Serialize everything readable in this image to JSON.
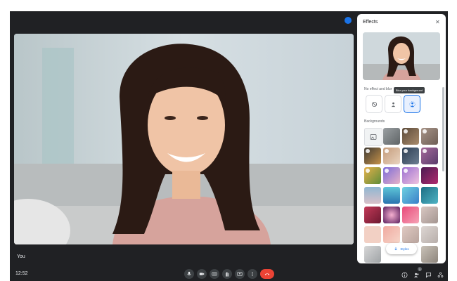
{
  "meeting": {
    "self_label": "You",
    "time": "12:52"
  },
  "effects_panel": {
    "title": "Effects",
    "close_glyph": "✕",
    "no_effect_section": "No effect and blur",
    "tooltip": "Blur your background",
    "backgrounds_section": "Backgrounds",
    "styles_label": "Styles"
  },
  "colors": {
    "accent": "#1a73e8",
    "end_call": "#ea4335",
    "toolbar": "#202124"
  },
  "controls": {
    "bottom_center": [
      "mic-icon",
      "camera-icon",
      "captions-icon",
      "raise-hand-icon",
      "present-icon",
      "more-options-icon",
      "end-call-icon"
    ],
    "bottom_right": [
      "info-icon",
      "people-icon",
      "chat-icon",
      "activities-icon"
    ],
    "participant_count": "1"
  }
}
